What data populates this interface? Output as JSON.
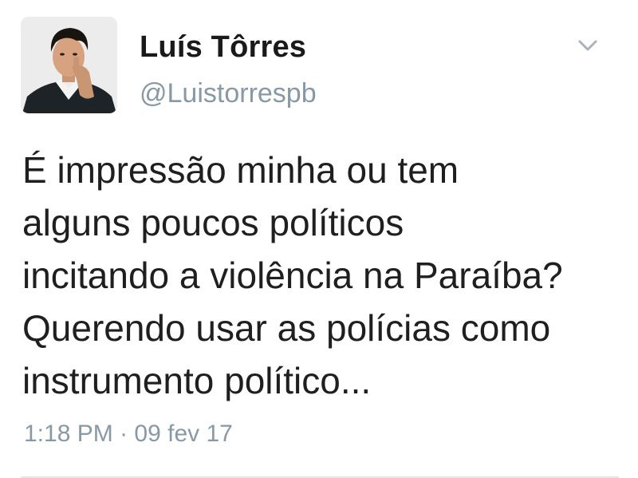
{
  "author": {
    "display_name": "Luís Tôrres",
    "handle": "@Luistorrespb"
  },
  "tweet": {
    "lines": [
      "É impressão minha ou tem",
      "alguns poucos políticos",
      "incitando a violência na Paraíba?",
      "Querendo usar as polícias como",
      "instrumento político..."
    ],
    "time": "1:18 PM",
    "separator": "·",
    "date": "09 fev 17"
  },
  "icons": {
    "menu": "chevron-down-icon",
    "avatar": "profile-photo"
  },
  "colors": {
    "text": "#1f1f1f",
    "secondary": "#8899a6",
    "divider": "#e1e8ed"
  }
}
